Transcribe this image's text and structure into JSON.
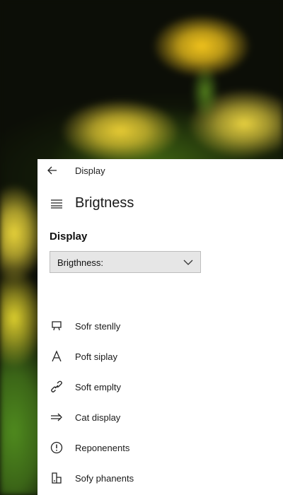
{
  "window": {
    "title": "Display"
  },
  "header": {
    "title": "Brigtness"
  },
  "section": {
    "title": "Display"
  },
  "dropdown": {
    "value": "Brigthness:"
  },
  "menu": {
    "items": [
      {
        "label": "Sofr stenlly",
        "icon": "monitor-icon"
      },
      {
        "label": "Poft siplay",
        "icon": "font-icon"
      },
      {
        "label": "Soft emplty",
        "icon": "link-icon"
      },
      {
        "label": "Cat display",
        "icon": "arrow-right-icon"
      },
      {
        "label": "Reponenents",
        "icon": "clock-icon"
      },
      {
        "label": "Sofy phanents",
        "icon": "phone-icon"
      }
    ]
  },
  "colors": {
    "panel": "#ffffff",
    "dropdown_bg": "#e6e6e6",
    "text": "#1a1a1a"
  }
}
